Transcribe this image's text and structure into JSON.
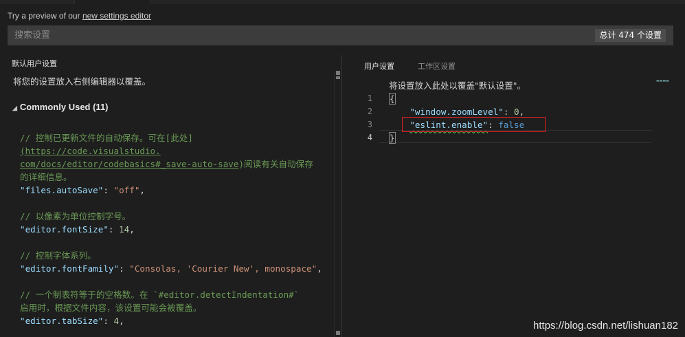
{
  "preview": {
    "prefix": "Try a preview of our ",
    "link": "new settings editor"
  },
  "search": {
    "placeholder": "搜索设置",
    "count_badge": "总计 474 个设置"
  },
  "left": {
    "title": "默认用户设置",
    "subtitle": "将您的设置放入右侧编辑器以覆盖。",
    "group": {
      "label": "Commonly Used (11)"
    },
    "code": {
      "c1a": "// 控制已更新文件的自动保存。可在[此处]",
      "c1b": "(https://code.visualstudio.",
      "c1c1": "com/docs/editor/codebasics#_save-auto-save",
      "c1c2": ")阅读有关自动保存",
      "c1d": "的详细信息。",
      "k1": "\"files.autoSave\"",
      "v1": "\"off\"",
      "c2": "// 以像素为单位控制字号。",
      "k2": "\"editor.fontSize\"",
      "v2": "14",
      "c3": "// 控制字体系列。",
      "k3": "\"editor.fontFamily\"",
      "v3": "\"Consolas, 'Courier New', monospace\"",
      "c4a": "// 一个制表符等于的空格数。在 `#editor.detectIndentation#`",
      "c4b": "启用时，根据文件内容，该设置可能会被覆盖。",
      "k4": "\"editor.tabSize\"",
      "v4": "4"
    }
  },
  "right": {
    "tabs": [
      {
        "label": "用户设置"
      },
      {
        "label": "工作区设置"
      }
    ],
    "subtitle": "将设置放入此处以覆盖\"默认设置\"。",
    "lines": [
      "1",
      "2",
      "3",
      "4"
    ],
    "code": {
      "open": "{",
      "k1": "\"window.zoomLevel\"",
      "v1": "0",
      "k2": "\"eslint.enable\"",
      "v2": "false",
      "close": "}"
    }
  },
  "watermark": "https://blog.csdn.net/lishuan182",
  "colors": {
    "comment": "#6a9955",
    "key": "#9cdcfe",
    "string": "#ce9178",
    "number": "#b5cea8",
    "boolean": "#569cd6",
    "highlight_box": "#e02020"
  }
}
